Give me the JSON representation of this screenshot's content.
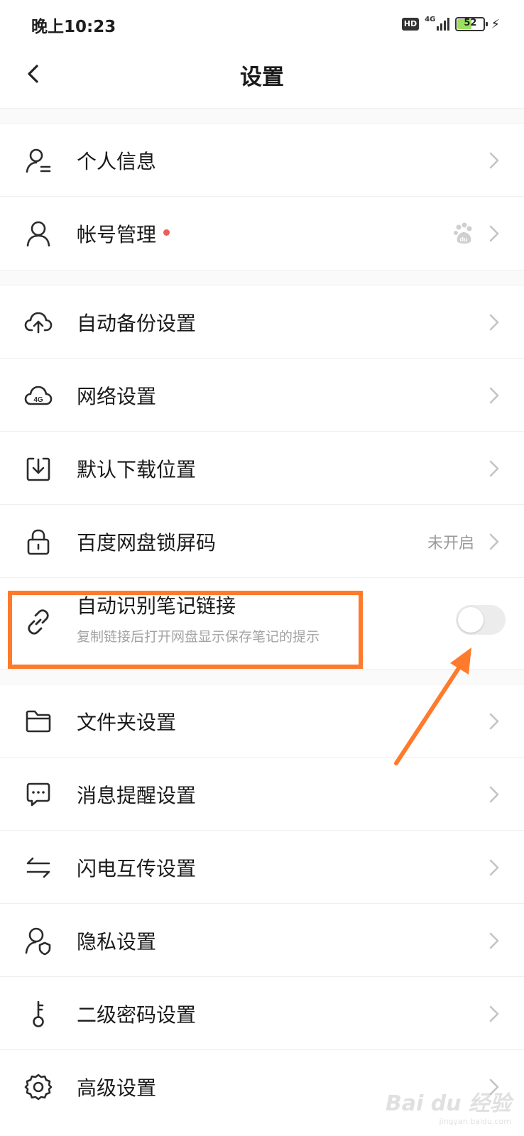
{
  "status_bar": {
    "time": "晚上10:23",
    "hd": "HD",
    "network": "4G",
    "battery": "52",
    "battery_level": 0.52
  },
  "header": {
    "title": "设置"
  },
  "rows": [
    {
      "label": "个人信息",
      "icon": "person-card-icon"
    },
    {
      "label": "帐号管理",
      "icon": "person-icon",
      "has_dot": true,
      "extra_icon": "baidu-paw-icon"
    },
    {
      "label": "自动备份设置",
      "icon": "cloud-upload-icon"
    },
    {
      "label": "网络设置",
      "icon": "cloud-4g-icon",
      "badge": "4G"
    },
    {
      "label": "默认下载位置",
      "icon": "download-box-icon"
    },
    {
      "label": "百度网盘锁屏码",
      "icon": "lock-icon",
      "value": "未开启"
    },
    {
      "label": "自动识别笔记链接",
      "icon": "link-icon",
      "subtitle": "复制链接后打开网盘显示保存笔记的提示",
      "toggle_on": false
    },
    {
      "label": "文件夹设置",
      "icon": "folder-icon"
    },
    {
      "label": "消息提醒设置",
      "icon": "message-icon"
    },
    {
      "label": "闪电互传设置",
      "icon": "transfer-arrows-icon"
    },
    {
      "label": "隐私设置",
      "icon": "privacy-shield-icon"
    },
    {
      "label": "二级密码设置",
      "icon": "key-icon"
    },
    {
      "label": "高级设置",
      "icon": "gear-icon"
    }
  ],
  "watermark": {
    "main": "Bai du 经验",
    "sub": "jingyan.baidu.com"
  },
  "colors": {
    "accent_orange": "#ff7a2b",
    "red_dot": "#f25b5b",
    "battery_green": "#9be15d"
  }
}
